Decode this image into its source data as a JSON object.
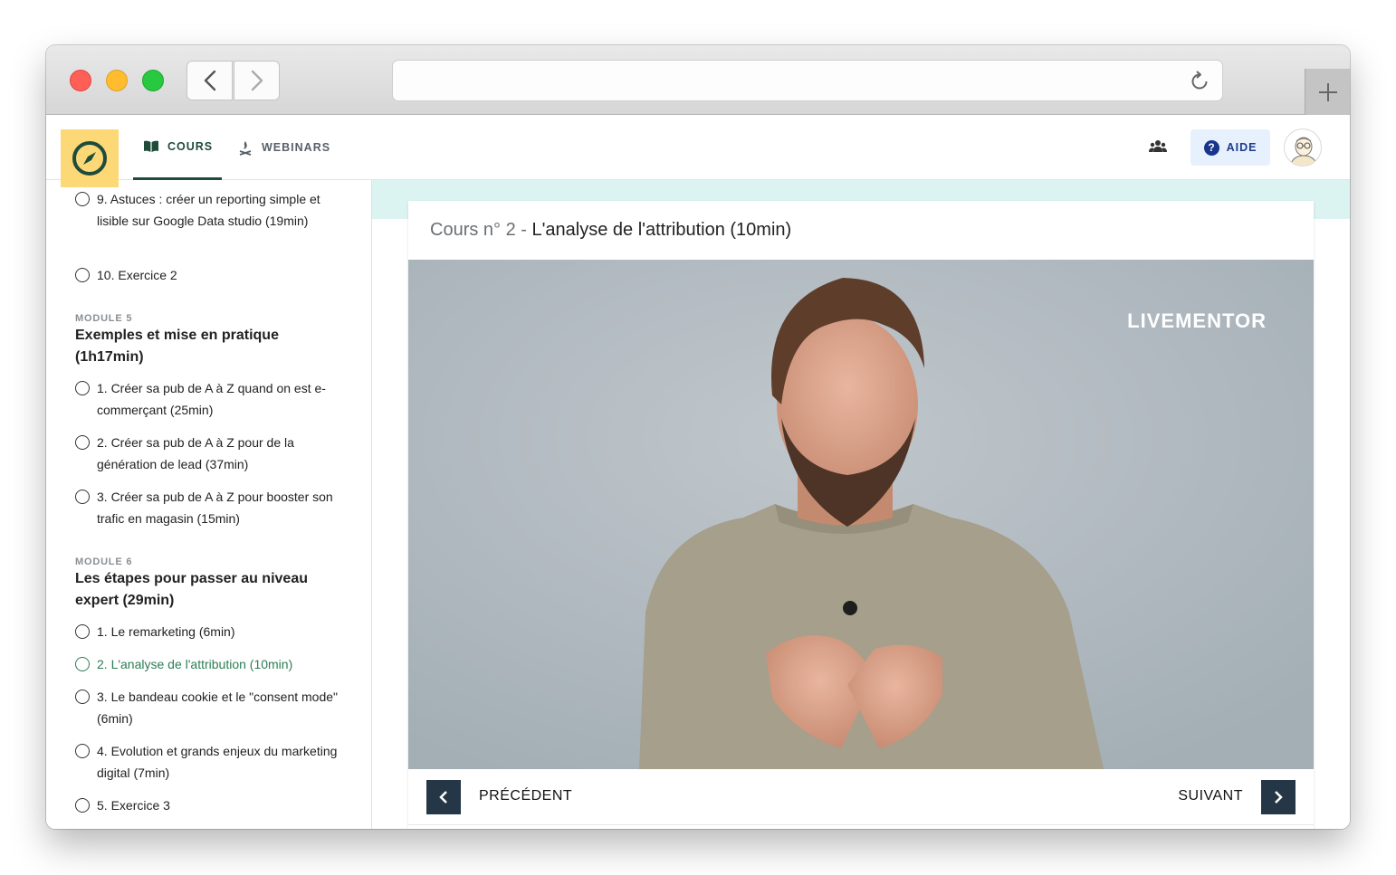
{
  "header": {
    "nav": [
      {
        "label": "COURS",
        "icon": "book-icon",
        "active": true
      },
      {
        "label": "WEBINARS",
        "icon": "campfire-icon",
        "active": false
      }
    ],
    "help_label": "AIDE",
    "help_icon_glyph": "?"
  },
  "sidebar": {
    "lessons_top": [
      {
        "label": "9. Astuces : créer un reporting simple et lisible sur Google Data studio (19min)"
      },
      {
        "label": "10. Exercice 2"
      }
    ],
    "modules": [
      {
        "label": "MODULE 5",
        "title": "Exemples et mise en pratique (1h17min)",
        "lessons": [
          {
            "label": "1. Créer sa pub de A à Z quand on est e-commerçant (25min)"
          },
          {
            "label": "2. Créer sa pub de A à Z pour de la génération de lead (37min)"
          },
          {
            "label": "3. Créer sa pub de A à Z pour booster son trafic en magasin (15min)"
          }
        ]
      },
      {
        "label": "MODULE 6",
        "title": "Les étapes pour passer au niveau expert (29min)",
        "lessons": [
          {
            "label": "1. Le remarketing (6min)"
          },
          {
            "label": "2. L'analyse de l'attribution (10min)",
            "active": true
          },
          {
            "label": "3. Le bandeau cookie et le \"consent mode\" (6min)"
          },
          {
            "label": "4. Evolution et grands enjeux du marketing digital (7min)"
          },
          {
            "label": "5. Exercice 3"
          }
        ]
      }
    ]
  },
  "lesson": {
    "prefix": "Cours n° 2 - ",
    "title": "L'analyse de l'attribution (10min)",
    "video_watermark": "LIVEMENTOR"
  },
  "pager": {
    "prev_label": "PRÉCÉDENT",
    "next_label": "SUIVANT"
  },
  "colors": {
    "brand_green": "#1f4c3a",
    "active_lesson": "#2b7d55",
    "logo_bg": "#fcd877",
    "help_bg": "#e7f0fd",
    "band": "#dcf4f1",
    "pager_button": "#253746"
  }
}
